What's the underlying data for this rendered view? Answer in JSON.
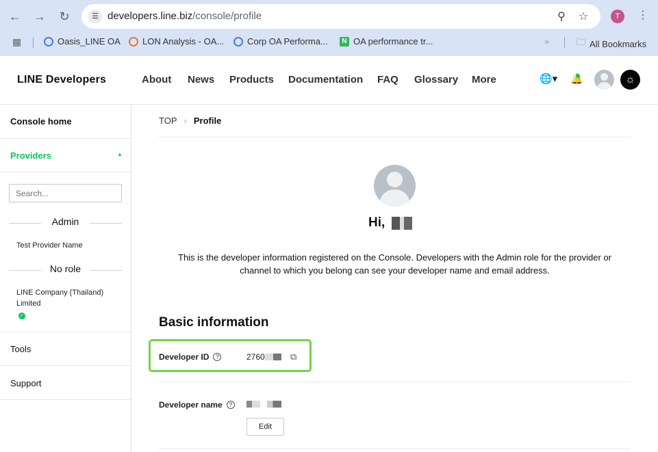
{
  "browser": {
    "url_host": "developers.line.biz",
    "url_path": "/console/profile",
    "profile_initial": "T",
    "bookmarks": [
      {
        "label": "Oasis_LINE OA"
      },
      {
        "label": "LON Analysis - OA..."
      },
      {
        "label": "Corp OA Performa..."
      },
      {
        "label": "OA performance tr..."
      }
    ],
    "overflow": "»",
    "all_bookmarks": "All Bookmarks"
  },
  "header": {
    "logo": "LINE Developers",
    "nav": [
      "About",
      "News",
      "Products",
      "Documentation",
      "FAQ",
      "Glossary",
      "More"
    ]
  },
  "sidebar": {
    "console_home": "Console home",
    "providers": "Providers",
    "search_placeholder": "Search...",
    "admin_heading": "Admin",
    "admin_provider": "Test Provider Name",
    "norole_heading": "No role",
    "norole_provider": "LINE Company (Thailand) Limited",
    "tools": "Tools",
    "support": "Support"
  },
  "main": {
    "breadcrumb_top": "TOP",
    "breadcrumb_current": "Profile",
    "greeting": "Hi,",
    "intro": "This is the developer information registered on the Console. Developers with the Admin role for the provider or channel to which you belong can see your developer name and email address.",
    "section_title": "Basic information",
    "developer_id_label": "Developer ID",
    "developer_id_value": "2760",
    "developer_name_label": "Developer name",
    "edit_label": "Edit"
  },
  "colors": {
    "accent_green": "#06c755",
    "highlight_green": "#73d14f",
    "chrome_bg": "#d8e3f6"
  }
}
